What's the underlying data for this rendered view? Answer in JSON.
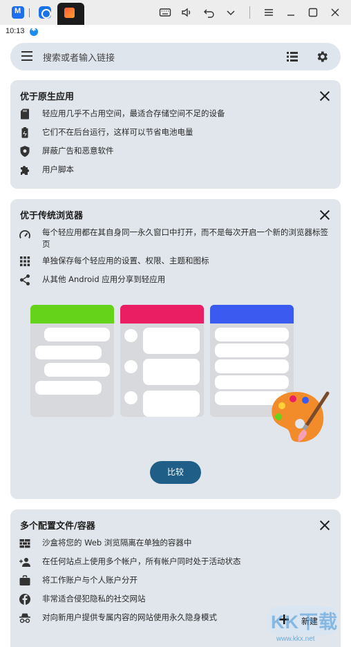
{
  "status_bar": {
    "time": "10:13"
  },
  "search": {
    "placeholder": "搜索或者输入链接"
  },
  "cards": [
    {
      "title": "优于原生应用",
      "features": [
        {
          "icon": "sd-card-icon",
          "text": "轻应用几乎不占用空间，最适合存储空间不足的设备"
        },
        {
          "icon": "battery-icon",
          "text": "它们不在后台运行，这样可以节省电池电量"
        },
        {
          "icon": "shield-icon",
          "text": "屏蔽广告和恶意软件"
        },
        {
          "icon": "puzzle-icon",
          "text": "用户脚本"
        }
      ]
    },
    {
      "title": "优于传统浏览器",
      "features": [
        {
          "icon": "speed-icon",
          "text": "每个轻应用都在其自身同一永久窗口中打开，而不是每次开启一个新的浏览器标签页"
        },
        {
          "icon": "grid-icon",
          "text": "单独保存每个轻应用的设置、权限、主题和图标"
        },
        {
          "icon": "share-icon",
          "text": "从其他 Android 应用分享到轻应用"
        }
      ],
      "button": "比较",
      "illustration_colors": [
        "#65d319",
        "#e91e63",
        "#3b5af0"
      ]
    },
    {
      "title": "多个配置文件/容器",
      "features": [
        {
          "icon": "blocks-icon",
          "text": "沙盒将您的 Web 浏览隔离在单独的容器中"
        },
        {
          "icon": "add-user-icon",
          "text": "在任何站点上使用多个帐户，所有帐户同时处于活动状态"
        },
        {
          "icon": "briefcase-icon",
          "text": "将工作账户与个人账户分开"
        },
        {
          "icon": "facebook-icon",
          "text": "非常适合侵犯隐私的社交网站"
        },
        {
          "icon": "incognito-icon",
          "text": "对向新用户提供专属内容的网站使用永久隐身模式"
        }
      ]
    }
  ],
  "fab": {
    "plus": "+",
    "label": "新建"
  },
  "watermark": {
    "text": "KK下载",
    "url": "www.kkx.net"
  },
  "colors": {
    "card_bg": "#e0e6ec",
    "button_bg": "#1f5e86",
    "search_bg": "#dfe5ec"
  }
}
